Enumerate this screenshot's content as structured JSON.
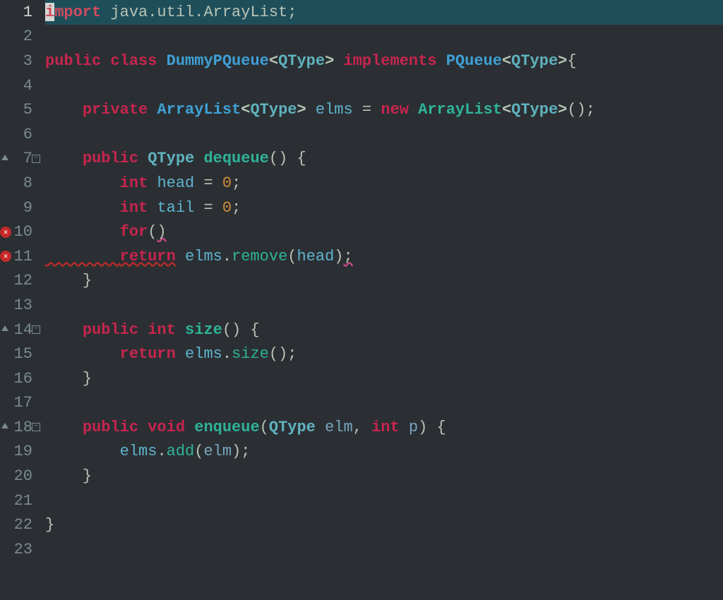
{
  "editor": {
    "currentLine": 1,
    "lines": [
      {
        "num": 1,
        "markers": [],
        "highlighted": true,
        "tokens": [
          {
            "cls": "cursor",
            "text": ""
          },
          {
            "cls": "kw-red",
            "text": "import"
          },
          {
            "cls": "text",
            "text": " java.util.ArrayList;"
          }
        ]
      },
      {
        "num": 2,
        "markers": [],
        "tokens": []
      },
      {
        "num": 3,
        "markers": [],
        "tokens": [
          {
            "cls": "kw",
            "text": "public"
          },
          {
            "cls": "text",
            "text": " "
          },
          {
            "cls": "kw",
            "text": "class"
          },
          {
            "cls": "text",
            "text": " "
          },
          {
            "cls": "classname",
            "text": "DummyPQueue"
          },
          {
            "cls": "angle",
            "text": "<"
          },
          {
            "cls": "type-cyan",
            "text": "QType"
          },
          {
            "cls": "angle",
            "text": ">"
          },
          {
            "cls": "text",
            "text": " "
          },
          {
            "cls": "kw",
            "text": "implements"
          },
          {
            "cls": "text",
            "text": " "
          },
          {
            "cls": "classname2",
            "text": "PQueue"
          },
          {
            "cls": "angle",
            "text": "<"
          },
          {
            "cls": "type-cyan",
            "text": "QType"
          },
          {
            "cls": "angle",
            "text": ">"
          },
          {
            "cls": "punct",
            "text": "{"
          }
        ]
      },
      {
        "num": 4,
        "markers": [],
        "tokens": []
      },
      {
        "num": 5,
        "markers": [],
        "tokens": [
          {
            "cls": "text",
            "text": "    "
          },
          {
            "cls": "kw",
            "text": "private"
          },
          {
            "cls": "text",
            "text": " "
          },
          {
            "cls": "classname",
            "text": "ArrayList"
          },
          {
            "cls": "angle",
            "text": "<"
          },
          {
            "cls": "type-cyan",
            "text": "QType"
          },
          {
            "cls": "angle",
            "text": ">"
          },
          {
            "cls": "text",
            "text": " "
          },
          {
            "cls": "var",
            "text": "elms"
          },
          {
            "cls": "text",
            "text": " = "
          },
          {
            "cls": "kw",
            "text": "new"
          },
          {
            "cls": "text",
            "text": " "
          },
          {
            "cls": "method",
            "text": "ArrayList"
          },
          {
            "cls": "angle",
            "text": "<"
          },
          {
            "cls": "type-cyan",
            "text": "QType"
          },
          {
            "cls": "angle",
            "text": ">"
          },
          {
            "cls": "punct",
            "text": "();"
          }
        ]
      },
      {
        "num": 6,
        "markers": [],
        "tokens": []
      },
      {
        "num": 7,
        "markers": [
          "override",
          "fold"
        ],
        "tokens": [
          {
            "cls": "text",
            "text": "    "
          },
          {
            "cls": "kw",
            "text": "public"
          },
          {
            "cls": "text",
            "text": " "
          },
          {
            "cls": "type-cyan",
            "text": "QType"
          },
          {
            "cls": "text",
            "text": " "
          },
          {
            "cls": "method",
            "text": "dequeue"
          },
          {
            "cls": "punct",
            "text": "() {"
          }
        ]
      },
      {
        "num": 8,
        "markers": [],
        "tokens": [
          {
            "cls": "text",
            "text": "        "
          },
          {
            "cls": "kw",
            "text": "int"
          },
          {
            "cls": "text",
            "text": " "
          },
          {
            "cls": "var",
            "text": "head"
          },
          {
            "cls": "text",
            "text": " = "
          },
          {
            "cls": "num",
            "text": "0"
          },
          {
            "cls": "punct",
            "text": ";"
          }
        ]
      },
      {
        "num": 9,
        "markers": [],
        "tokens": [
          {
            "cls": "text",
            "text": "        "
          },
          {
            "cls": "kw",
            "text": "int"
          },
          {
            "cls": "text",
            "text": " "
          },
          {
            "cls": "var",
            "text": "tail"
          },
          {
            "cls": "text",
            "text": " = "
          },
          {
            "cls": "num",
            "text": "0"
          },
          {
            "cls": "punct",
            "text": ";"
          }
        ]
      },
      {
        "num": 10,
        "markers": [
          "error"
        ],
        "tokens": [
          {
            "cls": "text",
            "text": "        "
          },
          {
            "cls": "kw",
            "text": "for"
          },
          {
            "cls": "punct",
            "text": "("
          },
          {
            "cls": "punct error-underline-pink",
            "text": ")"
          }
        ]
      },
      {
        "num": 11,
        "markers": [
          "error"
        ],
        "tokens": [
          {
            "cls": "text error-underline",
            "text": "        "
          },
          {
            "cls": "kw error-underline",
            "text": "return"
          },
          {
            "cls": "text",
            "text": " "
          },
          {
            "cls": "var",
            "text": "elms"
          },
          {
            "cls": "punct",
            "text": "."
          },
          {
            "cls": "method-call",
            "text": "remove"
          },
          {
            "cls": "punct",
            "text": "("
          },
          {
            "cls": "var",
            "text": "head"
          },
          {
            "cls": "punct",
            "text": ")"
          },
          {
            "cls": "punct error-underline-pink",
            "text": ";"
          }
        ]
      },
      {
        "num": 12,
        "markers": [],
        "tokens": [
          {
            "cls": "text",
            "text": "    "
          },
          {
            "cls": "punct",
            "text": "}"
          }
        ]
      },
      {
        "num": 13,
        "markers": [],
        "tokens": []
      },
      {
        "num": 14,
        "markers": [
          "override",
          "fold"
        ],
        "tokens": [
          {
            "cls": "text",
            "text": "    "
          },
          {
            "cls": "kw",
            "text": "public"
          },
          {
            "cls": "text",
            "text": " "
          },
          {
            "cls": "kw",
            "text": "int"
          },
          {
            "cls": "text",
            "text": " "
          },
          {
            "cls": "method",
            "text": "size"
          },
          {
            "cls": "punct",
            "text": "() {"
          }
        ]
      },
      {
        "num": 15,
        "markers": [],
        "tokens": [
          {
            "cls": "text",
            "text": "        "
          },
          {
            "cls": "kw",
            "text": "return"
          },
          {
            "cls": "text",
            "text": " "
          },
          {
            "cls": "var",
            "text": "elms"
          },
          {
            "cls": "punct",
            "text": "."
          },
          {
            "cls": "method-call",
            "text": "size"
          },
          {
            "cls": "punct",
            "text": "();"
          }
        ]
      },
      {
        "num": 16,
        "markers": [],
        "tokens": [
          {
            "cls": "text",
            "text": "    "
          },
          {
            "cls": "punct",
            "text": "}"
          }
        ]
      },
      {
        "num": 17,
        "markers": [],
        "tokens": []
      },
      {
        "num": 18,
        "markers": [
          "override",
          "fold"
        ],
        "tokens": [
          {
            "cls": "text",
            "text": "    "
          },
          {
            "cls": "kw",
            "text": "public"
          },
          {
            "cls": "text",
            "text": " "
          },
          {
            "cls": "kw",
            "text": "void"
          },
          {
            "cls": "text",
            "text": " "
          },
          {
            "cls": "method",
            "text": "enqueue"
          },
          {
            "cls": "punct",
            "text": "("
          },
          {
            "cls": "type-cyan",
            "text": "QType"
          },
          {
            "cls": "text",
            "text": " "
          },
          {
            "cls": "param",
            "text": "elm"
          },
          {
            "cls": "punct",
            "text": ", "
          },
          {
            "cls": "kw",
            "text": "int"
          },
          {
            "cls": "text",
            "text": " "
          },
          {
            "cls": "param",
            "text": "p"
          },
          {
            "cls": "punct",
            "text": ") {"
          }
        ]
      },
      {
        "num": 19,
        "markers": [],
        "tokens": [
          {
            "cls": "text",
            "text": "        "
          },
          {
            "cls": "var",
            "text": "elms"
          },
          {
            "cls": "punct",
            "text": "."
          },
          {
            "cls": "method-call",
            "text": "add"
          },
          {
            "cls": "punct",
            "text": "("
          },
          {
            "cls": "param",
            "text": "elm"
          },
          {
            "cls": "punct",
            "text": ");"
          }
        ]
      },
      {
        "num": 20,
        "markers": [],
        "tokens": [
          {
            "cls": "text",
            "text": "    "
          },
          {
            "cls": "punct",
            "text": "}"
          }
        ]
      },
      {
        "num": 21,
        "markers": [],
        "tokens": []
      },
      {
        "num": 22,
        "markers": [],
        "tokens": [
          {
            "cls": "punct",
            "text": "}"
          }
        ]
      },
      {
        "num": 23,
        "markers": [],
        "tokens": []
      }
    ]
  }
}
